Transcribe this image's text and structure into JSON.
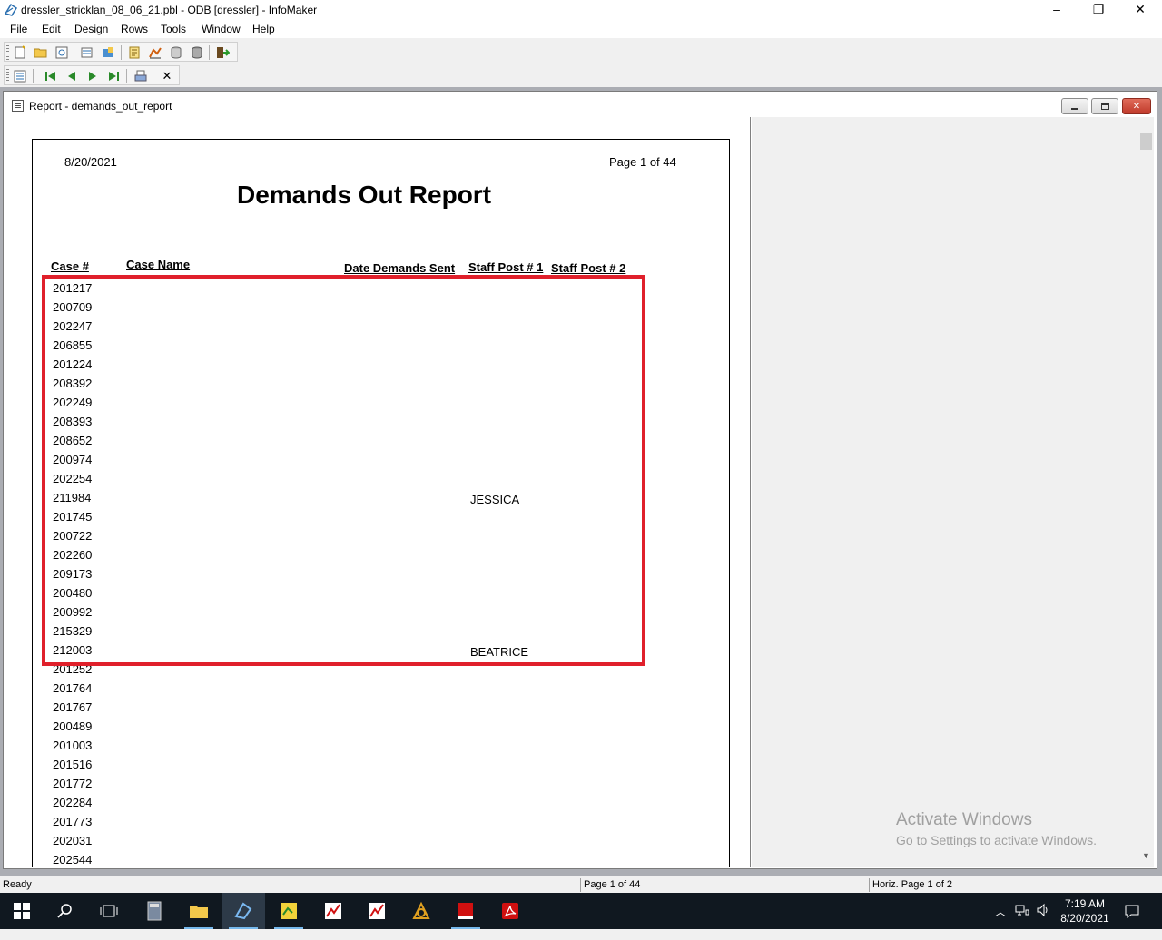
{
  "window": {
    "title": "dressler_stricklan_08_06_21.pbl - ODB [dressler] - InfoMaker",
    "minimize": "–",
    "restore": "❐",
    "close": "✕"
  },
  "menu": [
    "File",
    "Edit",
    "Design",
    "Rows",
    "Tools",
    "Window",
    "Help"
  ],
  "toolbar2": {
    "close_label": "✕"
  },
  "child": {
    "title": "Report - demands_out_report"
  },
  "report": {
    "date": "8/20/2021",
    "page": "Page 1 of 44",
    "title": "Demands Out Report",
    "headers": {
      "case_num": "Case #",
      "case_name": "Case Name",
      "date_sent": "Date Demands Sent",
      "staff1": "Staff Post # 1",
      "staff2": "Staff Post # 2"
    },
    "cases": [
      "201217",
      "200709",
      "202247",
      "206855",
      "201224",
      "208392",
      "202249",
      "208393",
      "208652",
      "200974",
      "202254",
      "211984",
      "201745",
      "200722",
      "202260",
      "209173",
      "200480",
      "200992",
      "215329",
      "212003",
      "201252",
      "201764",
      "201767",
      "200489",
      "201003",
      "201516",
      "201772",
      "202284",
      "201773",
      "202031",
      "202544"
    ],
    "staff_values": [
      {
        "row": 11,
        "text": "JESSICA"
      },
      {
        "row": 19,
        "text": "BEATRICE"
      }
    ]
  },
  "watermark": {
    "line1": "Activate Windows",
    "line2": "Go to Settings to activate Windows."
  },
  "status": {
    "ready": "Ready",
    "page": "Page 1 of 44",
    "horiz": "Horiz. Page 1 of 2"
  },
  "clock": {
    "time": "7:19 AM",
    "date": "8/20/2021"
  },
  "colors": {
    "highlight": "#e0202b",
    "taskbar": "#101820"
  }
}
